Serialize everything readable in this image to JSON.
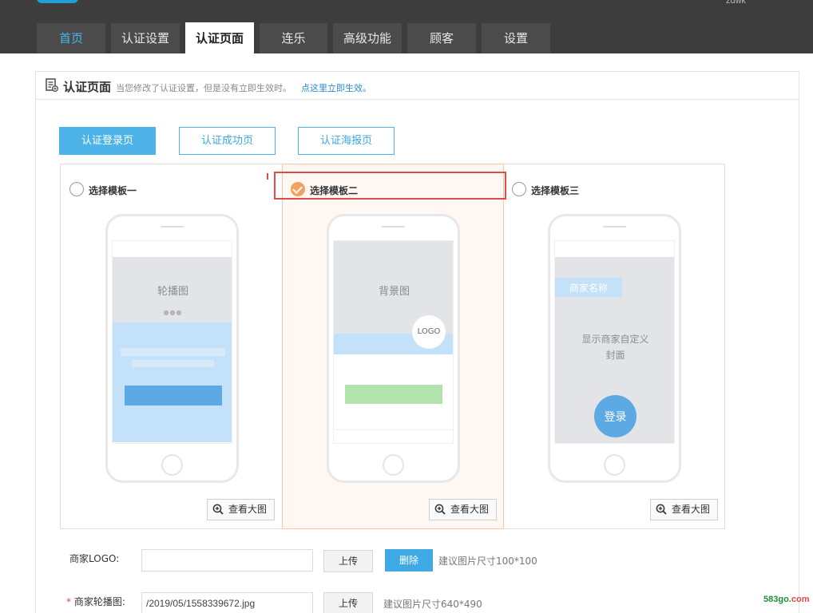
{
  "header": {
    "user_name": "zdwk",
    "tabs": [
      {
        "label": "首页"
      },
      {
        "label": "认证设置"
      },
      {
        "label": "认证页面"
      },
      {
        "label": "连乐"
      },
      {
        "label": "高级功能"
      },
      {
        "label": "顾客"
      },
      {
        "label": "设置"
      }
    ],
    "active_tab": "认证页面"
  },
  "panel": {
    "title": "认证页面",
    "note": "当您修改了认证设置，但是没有立即生效时。",
    "note_link": "点这里立即生效。"
  },
  "sub_tabs": [
    {
      "label": "认证登录页"
    },
    {
      "label": "认证成功页"
    },
    {
      "label": "认证海报页"
    }
  ],
  "templates": [
    {
      "label": "选择模板一",
      "checked": false,
      "banner_text": "轮播图",
      "dots": "●●●",
      "zoom_label": "查看大图"
    },
    {
      "label": "选择模板二",
      "checked": true,
      "bg_text": "背景图",
      "logo_text": "LOGO",
      "zoom_label": "查看大图"
    },
    {
      "label": "选择模板三",
      "checked": false,
      "merchant_name": "商家名称",
      "cover_line1": "显示商家自定义",
      "cover_line2": "封面",
      "login_text": "登录",
      "zoom_label": "查看大图"
    }
  ],
  "form": {
    "logo": {
      "label": "商家LOGO:",
      "value": "",
      "upload_label": "上传",
      "delete_label": "删除",
      "hint": "建议图片尺寸100*100"
    },
    "carousel": {
      "required_mark": "*",
      "label": "商家轮播图:",
      "value": "/2019/05/1558339672.jpg",
      "upload_label": "上传",
      "hint": "建议图片尺寸640*490"
    }
  },
  "watermark": {
    "main": "583go.",
    "suffix": "com"
  },
  "colors": {
    "nav_bg": "#3d3d3d",
    "accent_blue": "#4db3e8",
    "selected_orange": "#f5a15d",
    "highlight_red": "#e04a4a",
    "green_button": "#b3e3ad"
  },
  "icons": [
    "document-icon",
    "check-icon",
    "zoom-in-icon"
  ]
}
